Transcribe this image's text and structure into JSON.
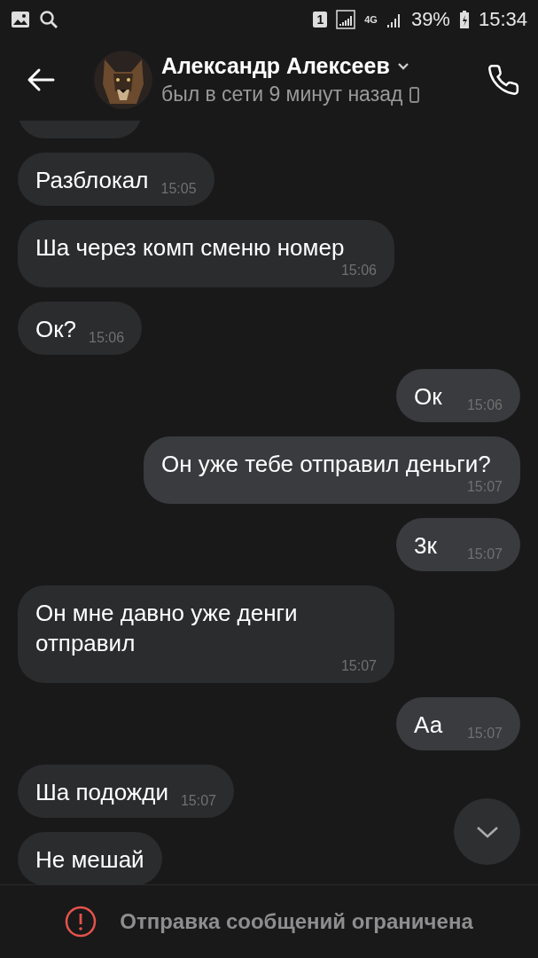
{
  "status_bar": {
    "sim": "1",
    "network": "4G",
    "battery": "39%",
    "time": "15:34"
  },
  "header": {
    "name": "Александр Алексеев",
    "status": "был в сети 9 минут назад"
  },
  "messages": [
    {
      "outgoing": false
    },
    {
      "text": "Разблокал",
      "time": "15:05",
      "outgoing": false
    },
    {
      "text": "Ша через комп сменю номер",
      "time": "15:06",
      "outgoing": false
    },
    {
      "text": "Ок?",
      "time": "15:06",
      "outgoing": false
    },
    {
      "text": "Ок",
      "time": "15:06",
      "outgoing": true
    },
    {
      "text": "Он уже тебе отправил деньги?",
      "time": "15:07",
      "outgoing": true
    },
    {
      "text": "3к",
      "time": "15:07",
      "outgoing": true
    },
    {
      "text": "Он мне давно уже денги отправил",
      "time": "15:07",
      "outgoing": false
    },
    {
      "text": "Аа",
      "time": "15:07",
      "outgoing": true
    },
    {
      "text": "Ша подожди",
      "time": "15:07",
      "outgoing": false
    },
    {
      "text": "Не мешай",
      "outgoing": false
    }
  ],
  "notice": "Отправка сообщений ограничена"
}
